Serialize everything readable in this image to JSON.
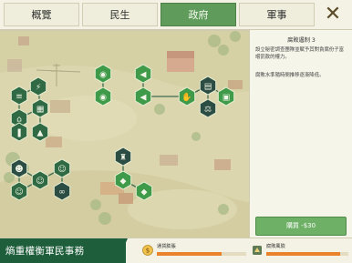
{
  "tabs": [
    {
      "label": "概覽",
      "active": false
    },
    {
      "label": "民生",
      "active": false
    },
    {
      "label": "政府",
      "active": true
    },
    {
      "label": "軍事",
      "active": false
    }
  ],
  "close_icon": "close-x-icon",
  "panel": {
    "title": "腐敗遏制 3",
    "description": "設立秘密調查團隊並賦予其對貪腐份子富嚐罰款的權力。",
    "effect": "腐敗水準隨時間推移逐漸降低。",
    "buy_label": "購買 -$30"
  },
  "bottom": {
    "title": "熵重權衡軍民事務",
    "meters": [
      {
        "label": "通貨膨脹",
        "icon": "inflation-icon",
        "level": 0.72
      },
      {
        "label": "腐敗風險",
        "icon": "corruption-icon",
        "level": 0.9
      }
    ]
  },
  "colors": {
    "accent_green": "#5f9b5a",
    "banner_green": "#1e5e3b",
    "node_dark": "#2f5a4a",
    "node_green": "#3c8a44",
    "meter_orange": "#e9822a"
  },
  "tech_nodes": [
    {
      "name": "node-grain-stack",
      "icon": "grain-icon",
      "state": "unlocked"
    },
    {
      "name": "node-power-tower",
      "icon": "tower-icon",
      "state": "unlocked"
    },
    {
      "name": "node-factory",
      "icon": "factory-icon",
      "state": "unlocked"
    },
    {
      "name": "node-storefront",
      "icon": "shop-icon",
      "state": "unlocked"
    },
    {
      "name": "node-stall",
      "icon": "stall-icon",
      "state": "unlocked"
    },
    {
      "name": "node-bottles",
      "icon": "bottles-icon",
      "state": "unlocked"
    },
    {
      "name": "node-eye-1",
      "icon": "eye-icon",
      "state": "available"
    },
    {
      "name": "node-eye-2",
      "icon": "eye-icon",
      "state": "available"
    },
    {
      "name": "node-megaphone-1",
      "icon": "megaphone-icon",
      "state": "available"
    },
    {
      "name": "node-megaphone-2",
      "icon": "megaphone-icon",
      "state": "available"
    },
    {
      "name": "node-handshake",
      "icon": "handshake-icon",
      "state": "available"
    },
    {
      "name": "node-card",
      "icon": "card-icon",
      "state": "locked"
    },
    {
      "name": "node-document",
      "icon": "document-icon",
      "state": "available"
    },
    {
      "name": "node-scales",
      "icon": "scales-icon",
      "state": "locked"
    },
    {
      "name": "node-people",
      "icon": "people-icon",
      "state": "locked"
    },
    {
      "name": "node-person-1",
      "icon": "person-icon",
      "state": "unlocked"
    },
    {
      "name": "node-person-2",
      "icon": "person-icon",
      "state": "unlocked"
    },
    {
      "name": "node-person-3",
      "icon": "person-icon",
      "state": "unlocked"
    },
    {
      "name": "node-binoculars",
      "icon": "binoculars-icon",
      "state": "locked"
    },
    {
      "name": "node-cup",
      "icon": "cup-icon",
      "state": "locked"
    },
    {
      "name": "node-shield-1",
      "icon": "shield-icon",
      "state": "available"
    },
    {
      "name": "node-shield-2",
      "icon": "shield-icon",
      "state": "available"
    }
  ]
}
